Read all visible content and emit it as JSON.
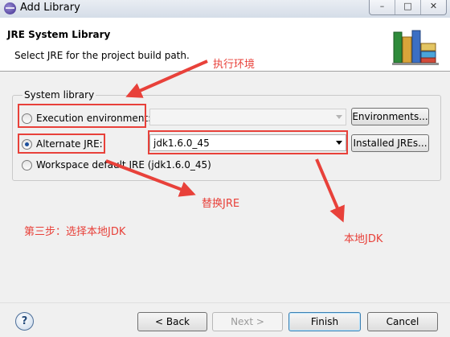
{
  "window": {
    "title": "Add Library",
    "controls": [
      "–",
      "□",
      "✕"
    ]
  },
  "header": {
    "title": "JRE System Library",
    "description": "Select JRE for the project build path."
  },
  "group": {
    "label": "System library",
    "execution_env": {
      "label": "Execution environment:",
      "value": "",
      "selected": false
    },
    "environments_button": "Environments...",
    "alternate_jre": {
      "label": "Alternate JRE:",
      "value": "jdk1.6.0_45",
      "selected": true
    },
    "installed_jres_button": "Installed JREs...",
    "workspace_default": {
      "label": "Workspace default JRE (jdk1.6.0_45)",
      "selected": false
    }
  },
  "annotations": {
    "exec_env": "执行环境",
    "replace_jre": "替换JRE",
    "step3": "第三步：选择本地JDK",
    "local_jdk": "本地JDK",
    "color": "#e8413a"
  },
  "footer": {
    "help": "?",
    "back": "< Back",
    "next": "Next >",
    "finish": "Finish",
    "cancel": "Cancel"
  }
}
